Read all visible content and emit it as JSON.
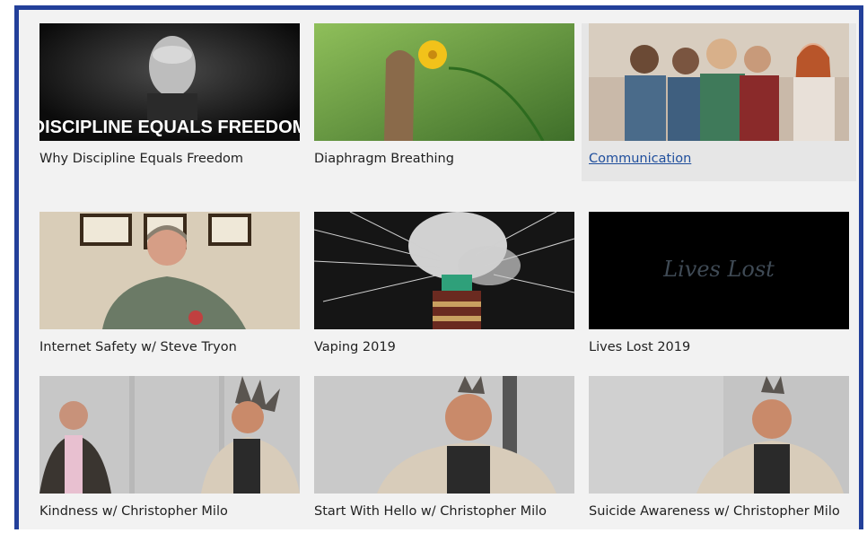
{
  "videos": [
    {
      "title": "Why Discipline Equals Freedom",
      "overlay_text": "DISCIPLINE EQUALS FREEDOM"
    },
    {
      "title": "Diaphragm Breathing"
    },
    {
      "title": "Communication",
      "state": "hovered-link"
    },
    {
      "title": "Internet Safety w/ Steve Tryon"
    },
    {
      "title": "Vaping 2019"
    },
    {
      "title": "Lives Lost 2019",
      "overlay_text": "Lives Lost"
    },
    {
      "title": "Kindness w/ Christopher Milo"
    },
    {
      "title": "Start With Hello w/ Christopher Milo"
    },
    {
      "title": "Suicide Awareness w/ Christopher Milo"
    }
  ],
  "colors": {
    "border": "#23409a",
    "background": "#f2f2f2",
    "link": "#1f4e9c"
  }
}
